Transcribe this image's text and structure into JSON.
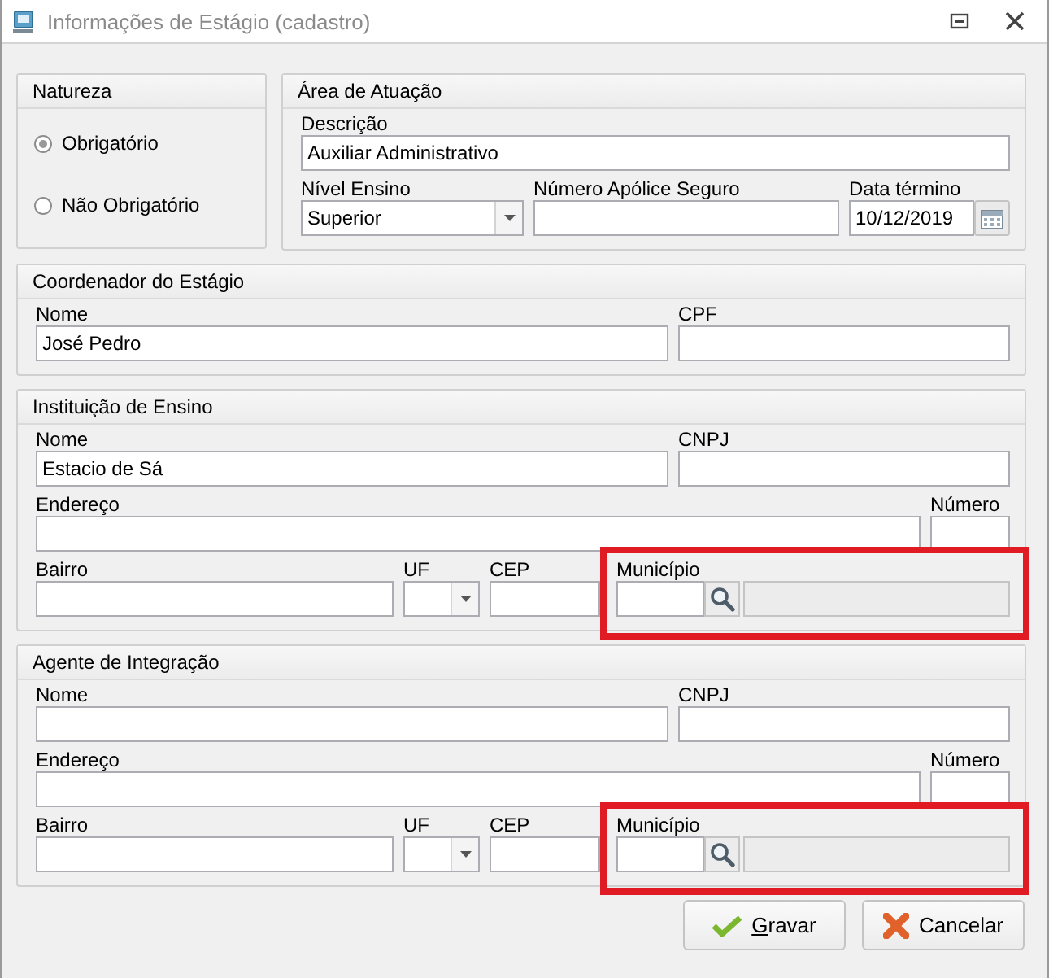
{
  "window": {
    "title": "Informações de Estágio (cadastro)"
  },
  "natureza": {
    "title": "Natureza",
    "options": [
      {
        "label": "Obrigatório",
        "selected": true
      },
      {
        "label": "Não Obrigatório",
        "selected": false
      }
    ]
  },
  "sections": [
    {
      "title": "Área de Atuação",
      "rows": [
        [
          {
            "kind": "text",
            "label": "Descrição",
            "value": "Auxiliar Administrativo"
          }
        ],
        [
          {
            "kind": "select",
            "label": "Nível Ensino",
            "value": "Superior"
          },
          {
            "kind": "text",
            "label": "Número Apólice Seguro"
          },
          {
            "kind": "date",
            "label": "Data término",
            "value": "10/12/2019"
          }
        ]
      ]
    },
    {
      "title": "Coordenador do Estágio",
      "rows": [
        [
          {
            "kind": "text",
            "label": "Nome",
            "value": "José Pedro"
          },
          {
            "kind": "text",
            "label": "CPF"
          }
        ]
      ]
    },
    {
      "title": "Instituição de Ensino",
      "rows": [
        [
          {
            "kind": "text",
            "label": "Nome",
            "value": "Estacio de Sá"
          },
          {
            "kind": "text",
            "label": "CNPJ"
          }
        ],
        [
          {
            "kind": "text",
            "label": "Endereço"
          },
          {
            "kind": "text",
            "label": "Número"
          }
        ],
        [
          {
            "kind": "text",
            "label": "Bairro"
          },
          {
            "kind": "select",
            "label": "UF"
          },
          {
            "kind": "text",
            "label": "CEP"
          },
          {
            "kind": "lookup",
            "label": "Município",
            "highlighted": true
          }
        ]
      ]
    },
    {
      "title": "Agente de Integração",
      "rows": [
        [
          {
            "kind": "text",
            "label": "Nome"
          },
          {
            "kind": "text",
            "label": "CNPJ"
          }
        ],
        [
          {
            "kind": "text",
            "label": "Endereço"
          },
          {
            "kind": "text",
            "label": "Número"
          }
        ],
        [
          {
            "kind": "text",
            "label": "Bairro"
          },
          {
            "kind": "select",
            "label": "UF"
          },
          {
            "kind": "text",
            "label": "CEP"
          },
          {
            "kind": "lookup",
            "label": "Município",
            "highlighted": true
          }
        ]
      ]
    }
  ],
  "buttons": [
    {
      "kind": "confirm",
      "label": "Gravar"
    },
    {
      "kind": "cancel",
      "label": "Cancelar"
    }
  ]
}
